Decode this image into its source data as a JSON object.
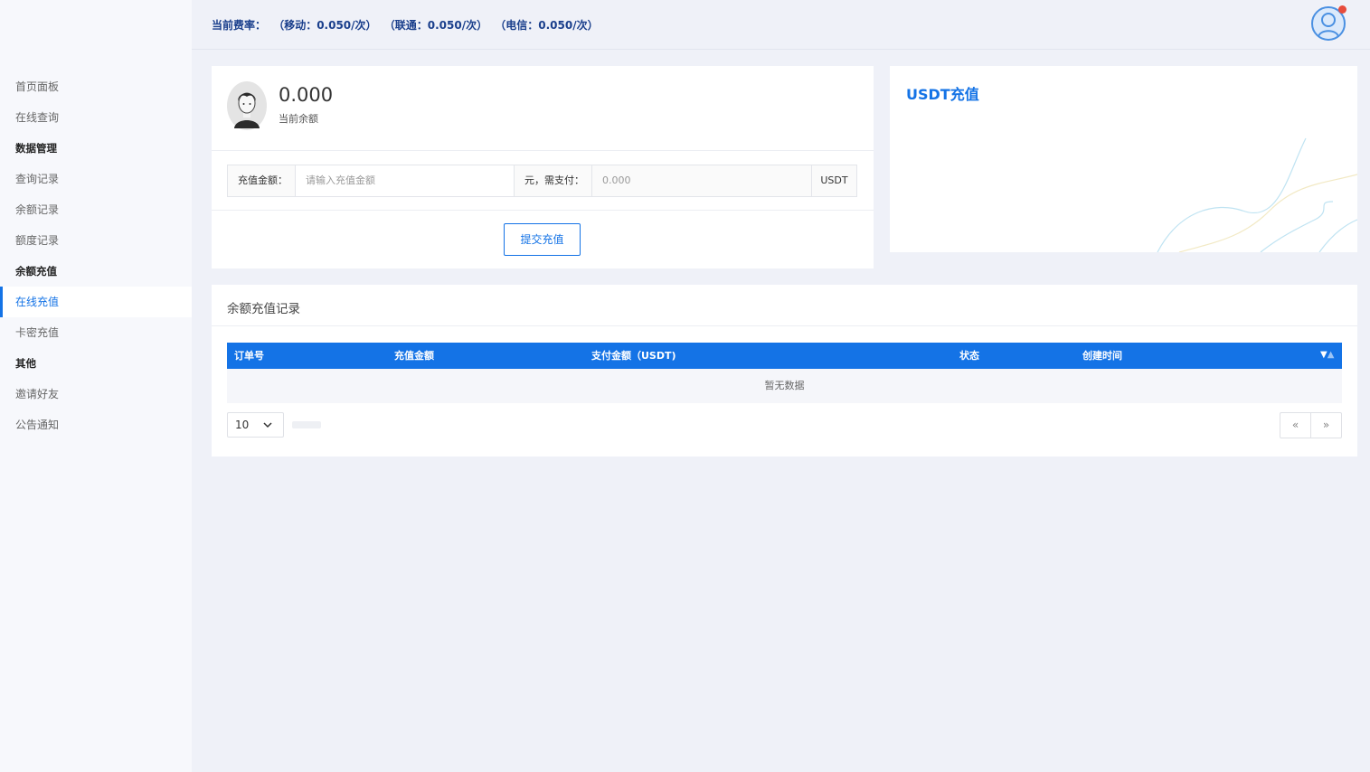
{
  "sidebar": {
    "items": [
      {
        "label": "首页面板",
        "type": "item"
      },
      {
        "label": "在线查询",
        "type": "item"
      },
      {
        "label": "数据管理",
        "type": "group"
      },
      {
        "label": "查询记录",
        "type": "item"
      },
      {
        "label": "余额记录",
        "type": "item"
      },
      {
        "label": "额度记录",
        "type": "item"
      },
      {
        "label": "余额充值",
        "type": "group"
      },
      {
        "label": "在线充值",
        "type": "item",
        "active": true
      },
      {
        "label": "卡密充值",
        "type": "item"
      },
      {
        "label": "其他",
        "type": "group"
      },
      {
        "label": "邀请好友",
        "type": "item"
      },
      {
        "label": "公告通知",
        "type": "item"
      }
    ]
  },
  "header": {
    "rate_label": "当前费率：",
    "rate_mobile": "（移动：0.050/次）",
    "rate_unicom": "（联通：0.050/次）",
    "rate_telecom": "（电信：0.050/次）",
    "avatar_icon": "user-avatar-icon",
    "notification_color": "#e74c3c"
  },
  "balance": {
    "amount": "0.000",
    "label": "当前余额"
  },
  "recharge_form": {
    "amount_label": "充值金额：",
    "amount_placeholder": "请输入充值金额",
    "pay_label": "元，需支付：",
    "pay_value": "0.000",
    "unit": "USDT",
    "submit_label": "提交充值"
  },
  "usdt_card": {
    "title": "USDT充值"
  },
  "records": {
    "title": "余额充值记录",
    "columns": [
      "订单号",
      "充值金额",
      "支付金额（USDT)",
      "状态",
      "创建时间"
    ],
    "empty_text": "暂无数据",
    "page_size": "10",
    "prev_label": "«",
    "next_label": "»"
  },
  "colors": {
    "accent": "#1473e6",
    "header_text": "#1a3f8c",
    "background": "#eff1f8"
  }
}
